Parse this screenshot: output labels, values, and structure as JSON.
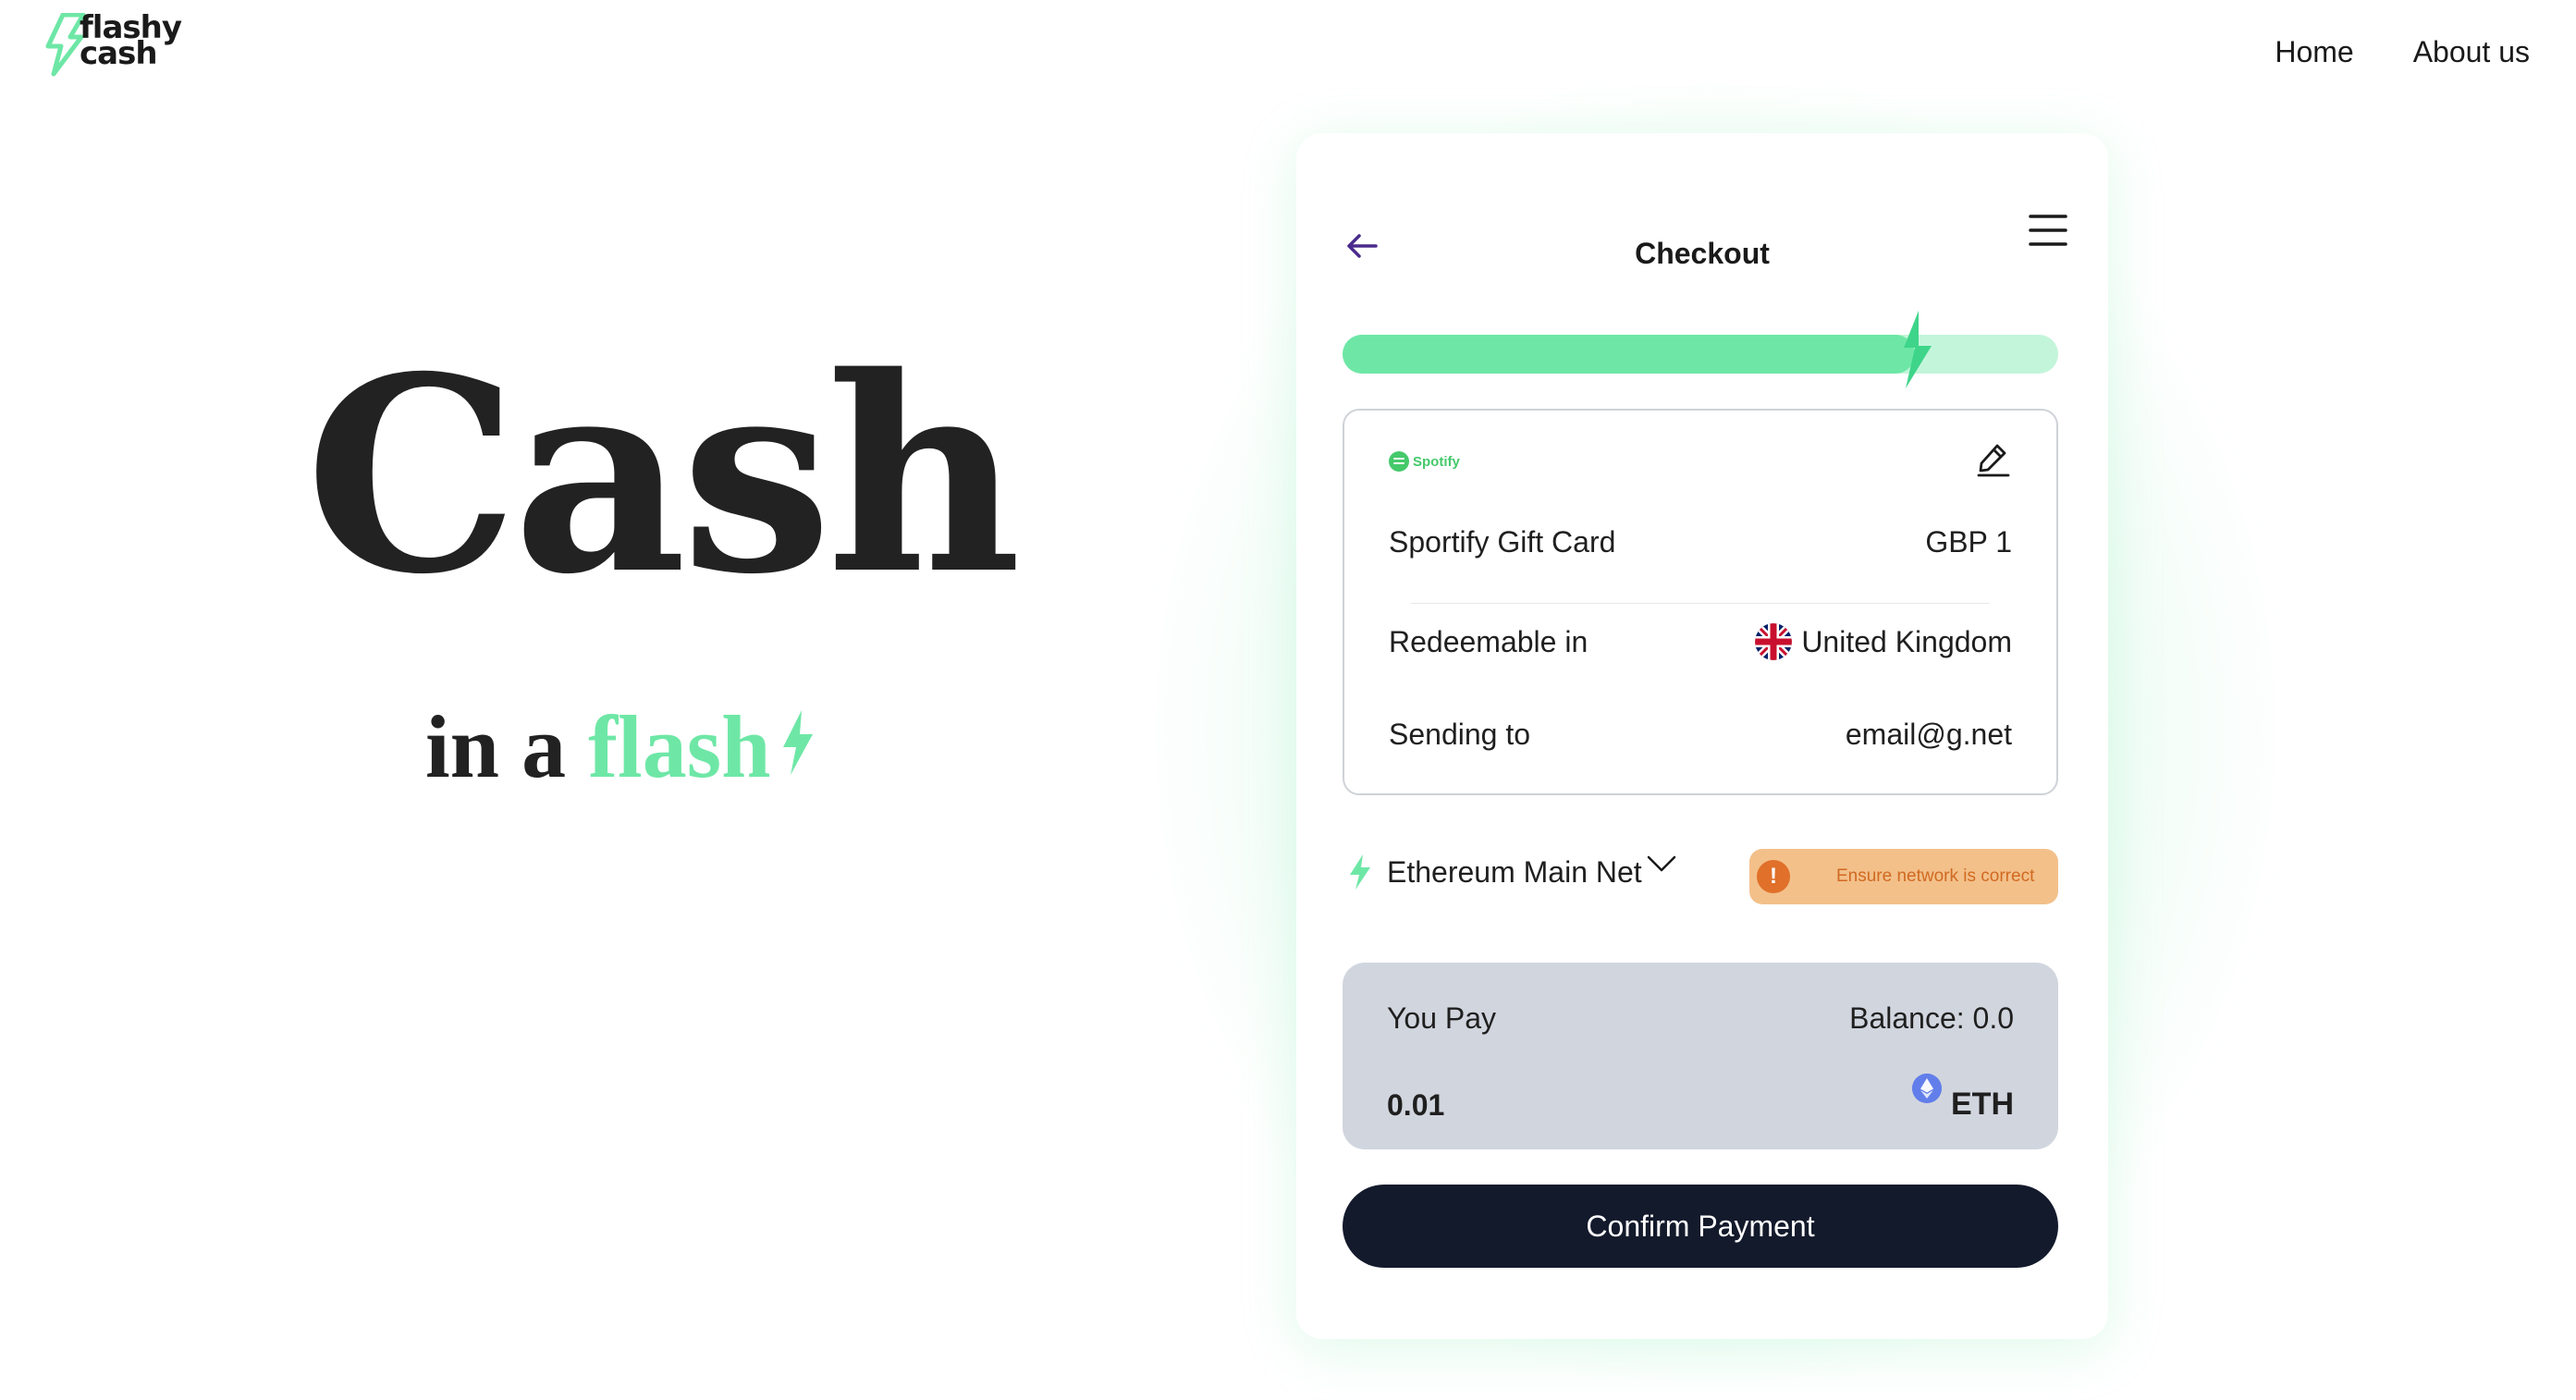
{
  "header": {
    "logo_text_line1": "flashy",
    "logo_text_line2": "cash",
    "nav": {
      "home": "Home",
      "about": "About us"
    }
  },
  "hero": {
    "title": "Cash",
    "subtitle_prefix": "in a ",
    "subtitle_accent": "flash"
  },
  "checkout": {
    "title": "Checkout",
    "progress": 0.8,
    "brand": "Spotify",
    "product": {
      "label": "Sportify Gift Card",
      "value": "GBP 1"
    },
    "redeemable": {
      "label": "Redeemable in",
      "value": "United Kingdom"
    },
    "sending": {
      "label": "Sending to",
      "value": "email@g.net"
    },
    "network": {
      "label": "Ethereum Main Net"
    },
    "warning": {
      "icon": "!",
      "text": "Ensure network is correct"
    },
    "pay": {
      "label": "You Pay",
      "balance": "Balance: 0.0",
      "amount": "0.01",
      "token": "ETH"
    },
    "confirm_label": "Confirm Payment"
  },
  "colors": {
    "accent": "#6ee7a6",
    "accent_light": "#c3f5da",
    "dark": "#131a2c",
    "warning_bg": "#f3c08a",
    "warning_text": "#d06a22",
    "back_arrow": "#4a2b8c",
    "pay_bg": "#d1d5de"
  },
  "icons": [
    "bolt-logo-icon",
    "back-arrow-icon",
    "hamburger-menu-icon",
    "edit-pencil-icon",
    "uk-flag-icon",
    "bolt-icon",
    "chevron-down-icon",
    "warning-icon",
    "eth-icon"
  ]
}
